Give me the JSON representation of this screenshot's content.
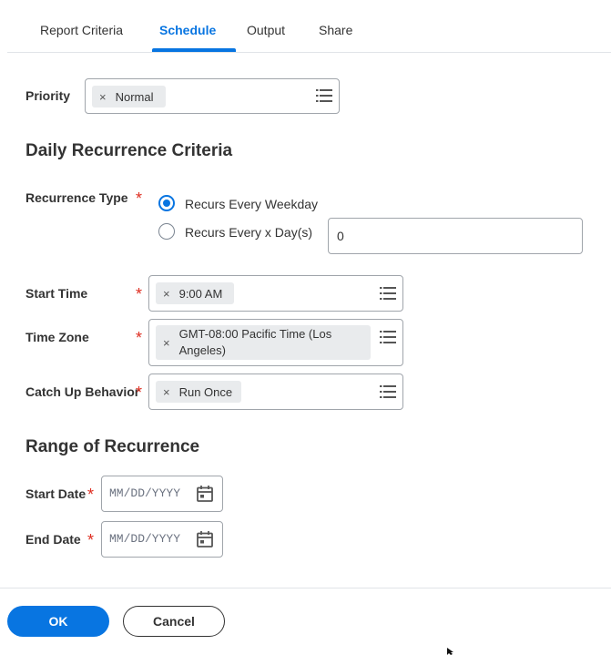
{
  "tabs": [
    {
      "label": "Report Criteria"
    },
    {
      "label": "Schedule"
    },
    {
      "label": "Output"
    },
    {
      "label": "Share"
    }
  ],
  "active_tab": "Schedule",
  "priority": {
    "label": "Priority",
    "value": "Normal"
  },
  "daily_section": {
    "title": "Daily Recurrence Criteria"
  },
  "recurrence_type": {
    "label": "Recurrence Type",
    "options": [
      {
        "label": "Recurs Every Weekday",
        "selected": true
      },
      {
        "label": "Recurs Every x Day(s)",
        "selected": false
      }
    ],
    "days_value": "0"
  },
  "start_time": {
    "label": "Start Time",
    "value": "9:00 AM"
  },
  "time_zone": {
    "label": "Time Zone",
    "value_line1": "GMT-08:00 Pacific Time (Los",
    "value_line2": "Angeles)"
  },
  "catch_up": {
    "label": "Catch Up Behavior",
    "value": "Run Once"
  },
  "range_section": {
    "title": "Range of Recurrence"
  },
  "start_date": {
    "label": "Start Date",
    "placeholder": "MM/DD/YYYY"
  },
  "end_date": {
    "label": "End Date",
    "placeholder": "MM/DD/YYYY"
  },
  "required_mark": "*",
  "remove_glyph": "×",
  "buttons": {
    "ok": "OK",
    "cancel": "Cancel"
  },
  "colors": {
    "accent": "#0875e1",
    "required": "#de2e21",
    "pill": "#e9ebed"
  },
  "icons": [
    "list-icon",
    "calendar-icon",
    "close-icon"
  ]
}
